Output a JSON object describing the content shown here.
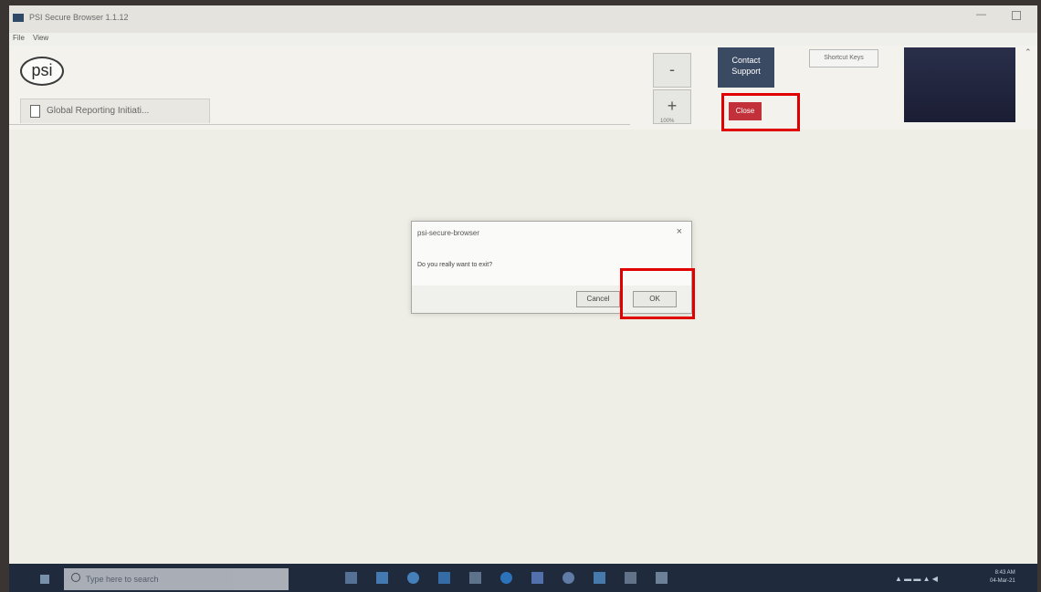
{
  "window": {
    "title": "PSI Secure Browser 1.1.12"
  },
  "menu": {
    "file": "File",
    "view": "View"
  },
  "logo": {
    "text": "psi"
  },
  "tab": {
    "label": "Global Reporting Initiati..."
  },
  "toolbar": {
    "zoom_out": "-",
    "zoom_in": "+",
    "zoom_level": "100%",
    "contact_support": "Contact Support",
    "shortcut_keys": "Shortcut Keys",
    "close": "Close"
  },
  "dialog": {
    "title": "psi-secure-browser",
    "close_symbol": "×",
    "message": "Do you really want to exit?",
    "cancel_label": "Cancel",
    "ok_label": "OK"
  },
  "taskbar": {
    "search_placeholder": "Type here to search",
    "time": "8:43 AM",
    "date": "04-Mar-21"
  },
  "colors": {
    "close_button": "#c2313a",
    "contact_button": "#3b4a63",
    "highlight": "#e00000",
    "taskbar": "#1f2b3d"
  }
}
